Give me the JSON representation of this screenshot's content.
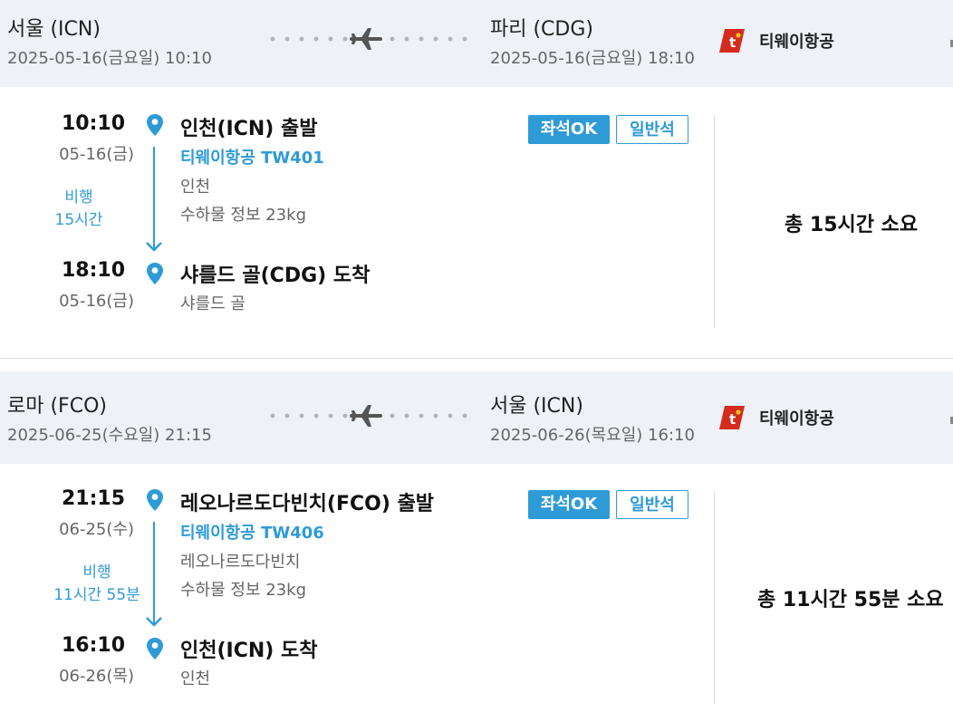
{
  "segments": [
    {
      "depart_city": "서울 (ICN)",
      "depart_datetime": "2025-05-16(금요일) 10:10",
      "arrive_city": "파리 (CDG)",
      "arrive_datetime": "2025-05-16(금요일) 18:10",
      "airline": "티웨이항공",
      "dep_time": "10:10",
      "dep_date": "05-16(금)",
      "dep_title": "인천(ICN) 출발",
      "flight": "티웨이항공 TW401",
      "dep_airport": "인천",
      "baggage": "수하물 정보 23kg",
      "duration_label": "비행",
      "duration": "15시간",
      "arr_time": "18:10",
      "arr_date": "05-16(금)",
      "arr_title": "샤를드 골(CDG) 도착",
      "arr_airport": "샤를드 골",
      "seat_status": "좌석OK",
      "cabin": "일반석",
      "total": "총 15시간 소요"
    },
    {
      "depart_city": "로마 (FCO)",
      "depart_datetime": "2025-06-25(수요일) 21:15",
      "arrive_city": "서울 (ICN)",
      "arrive_datetime": "2025-06-26(목요일) 16:10",
      "airline": "티웨이항공",
      "dep_time": "21:15",
      "dep_date": "06-25(수)",
      "dep_title": "레오나르도다빈치(FCO) 출발",
      "flight": "티웨이항공 TW406",
      "dep_airport": "레오나르도다빈치",
      "baggage": "수하물 정보 23kg",
      "duration_label": "비행",
      "duration": "11시간 55분",
      "arr_time": "16:10",
      "arr_date": "06-26(목)",
      "arr_title": "인천(ICN) 도착",
      "arr_airport": "인천",
      "seat_status": "좌석OK",
      "cabin": "일반석",
      "total": "총 11시간 55분 소요"
    }
  ],
  "colors": {
    "accent": "#2e9bd6",
    "header_bg": "#eef1f6",
    "logo_red": "#d52b1e"
  },
  "icons": {
    "route": "plane-icon",
    "stop": "location-pin-icon",
    "airline": "tway-logo"
  }
}
